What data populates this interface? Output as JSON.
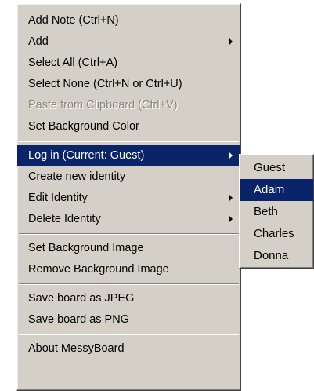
{
  "main_menu": {
    "group1": [
      {
        "label": "Add Note (Ctrl+N)"
      },
      {
        "label": "Add"
      },
      {
        "label": "Select All (Ctrl+A)"
      },
      {
        "label": "Select None (Ctrl+N or Ctrl+U)"
      },
      {
        "label": "Paste from Clipboard (Ctrl+V)"
      },
      {
        "label": "Set Background Color"
      }
    ],
    "group2": [
      {
        "label": "Log in (Current: Guest)"
      },
      {
        "label": "Create new identity"
      },
      {
        "label": "Edit Identity"
      },
      {
        "label": "Delete Identity"
      }
    ],
    "group3": [
      {
        "label": "Set Background Image"
      },
      {
        "label": "Remove Background Image"
      }
    ],
    "group4": [
      {
        "label": "Save board as JPEG"
      },
      {
        "label": "Save board as PNG"
      }
    ],
    "group5": [
      {
        "label": "About MessyBoard"
      }
    ]
  },
  "submenu": {
    "items": [
      {
        "label": "Guest"
      },
      {
        "label": "Adam"
      },
      {
        "label": "Beth"
      },
      {
        "label": "Charles"
      },
      {
        "label": "Donna"
      }
    ]
  },
  "colors": {
    "menu_background": "#d4d0c8",
    "highlight": "#0a246a",
    "disabled_text": "#8a8780"
  }
}
